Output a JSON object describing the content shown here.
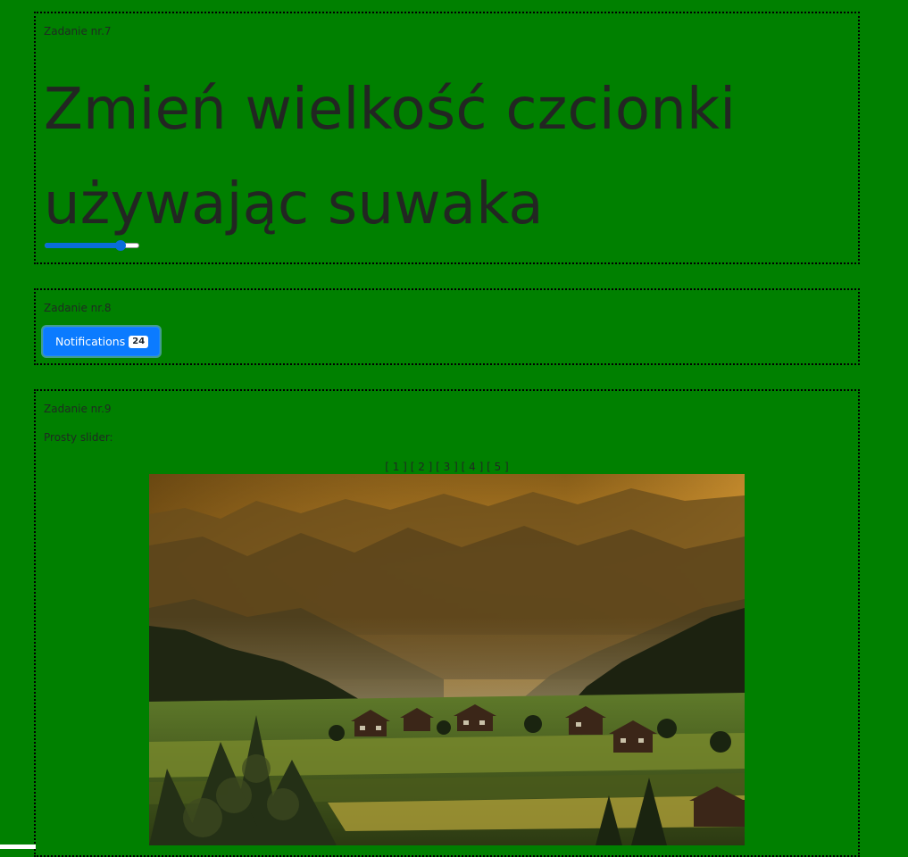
{
  "task7": {
    "label": "Zadanie nr.7",
    "heading": "Zmień wielkość czcionki używając suwaka",
    "slider_value": 0.8
  },
  "task8": {
    "label": "Zadanie nr.8",
    "button_label": "Notifications",
    "badge_count": "24",
    "button_color": "#0b7bff"
  },
  "task9": {
    "label": "Zadanie nr.9",
    "caption": "Prosty slider:",
    "nav": [
      "[ 1 ]",
      "[ 2 ]",
      "[ 3 ]",
      "[ 4 ]",
      "[ 5 ]"
    ],
    "image_icon": "landscape-image"
  },
  "colors": {
    "page_background": "#008000",
    "accent": "#0a6dd9"
  }
}
